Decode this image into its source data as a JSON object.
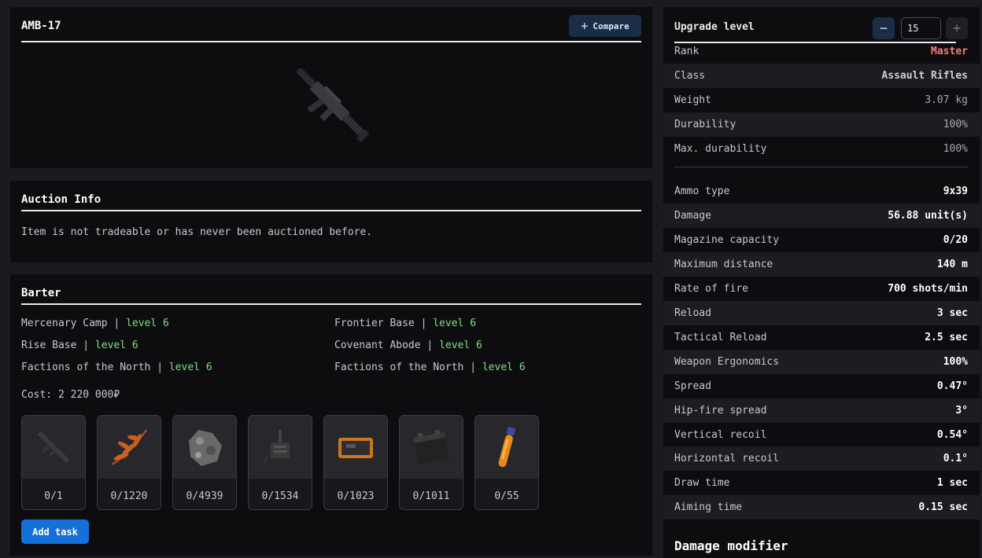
{
  "item": {
    "title": "AMB-17",
    "compare_label": "Compare",
    "image_icon": "rifle-icon"
  },
  "auction": {
    "title": "Auction Info",
    "text": "Item is not tradeable or has never been auctioned before."
  },
  "barter": {
    "title": "Barter",
    "locations": [
      {
        "name": "Mercenary Camp",
        "sep": "|",
        "level": "level 6"
      },
      {
        "name": "Frontier Base",
        "sep": "|",
        "level": "level 6"
      },
      {
        "name": "Rise Base",
        "sep": "|",
        "level": "level 6"
      },
      {
        "name": "Covenant Abode",
        "sep": "|",
        "level": "level 6"
      },
      {
        "name": "Factions of the North",
        "sep": "|",
        "level": "level 6"
      },
      {
        "name": "Factions of the North",
        "sep": "|",
        "level": "level 6"
      }
    ],
    "cost": "Cost: 2 220 000₽",
    "items": [
      {
        "icon": "gun-icon",
        "count": "0/1"
      },
      {
        "icon": "fern-icon",
        "count": "0/1220"
      },
      {
        "icon": "ore-icon",
        "count": "0/4939"
      },
      {
        "icon": "device-icon",
        "count": "0/1534"
      },
      {
        "icon": "case-icon",
        "count": "0/1023"
      },
      {
        "icon": "battery-icon",
        "count": "0/1011"
      },
      {
        "icon": "vial-icon",
        "count": "0/55"
      }
    ],
    "add_task_label": "Add task"
  },
  "stats": {
    "upgrade_label": "Upgrade level",
    "upgrade_value": "15",
    "minus_label": "−",
    "plus_label": "+",
    "rows_top": [
      {
        "label": "Rank",
        "value": "Master"
      },
      {
        "label": "Class",
        "value": "Assault Rifles"
      },
      {
        "label": "Weight",
        "value": "3.07 kg"
      },
      {
        "label": "Durability",
        "value": "100%"
      },
      {
        "label": "Max. durability",
        "value": "100%"
      }
    ],
    "rows_bottom": [
      {
        "label": "Ammo type",
        "value": "9x39"
      },
      {
        "label": "Damage",
        "value": "56.88 unit(s)"
      },
      {
        "label": "Magazine capacity",
        "value": "0/20"
      },
      {
        "label": "Maximum distance",
        "value": "140 m"
      },
      {
        "label": "Rate of fire",
        "value": "700 shots/min"
      },
      {
        "label": "Reload",
        "value": "3 sec"
      },
      {
        "label": "Tactical Reload",
        "value": "2.5 sec"
      },
      {
        "label": "Weapon Ergonomics",
        "value": "100%"
      },
      {
        "label": "Spread",
        "value": "0.47°"
      },
      {
        "label": "Hip-fire spread",
        "value": "3°"
      },
      {
        "label": "Vertical recoil",
        "value": "0.54°"
      },
      {
        "label": "Horizontal recoil",
        "value": "0.1°"
      },
      {
        "label": "Draw time",
        "value": "1 sec"
      },
      {
        "label": "Aiming time",
        "value": "0.15 sec"
      }
    ],
    "damage_modifier_title": "Damage modifier"
  },
  "colors": {
    "accent": "#1570d9",
    "rank_color": "#ff7a7a",
    "level_color": "#7fe07f"
  }
}
